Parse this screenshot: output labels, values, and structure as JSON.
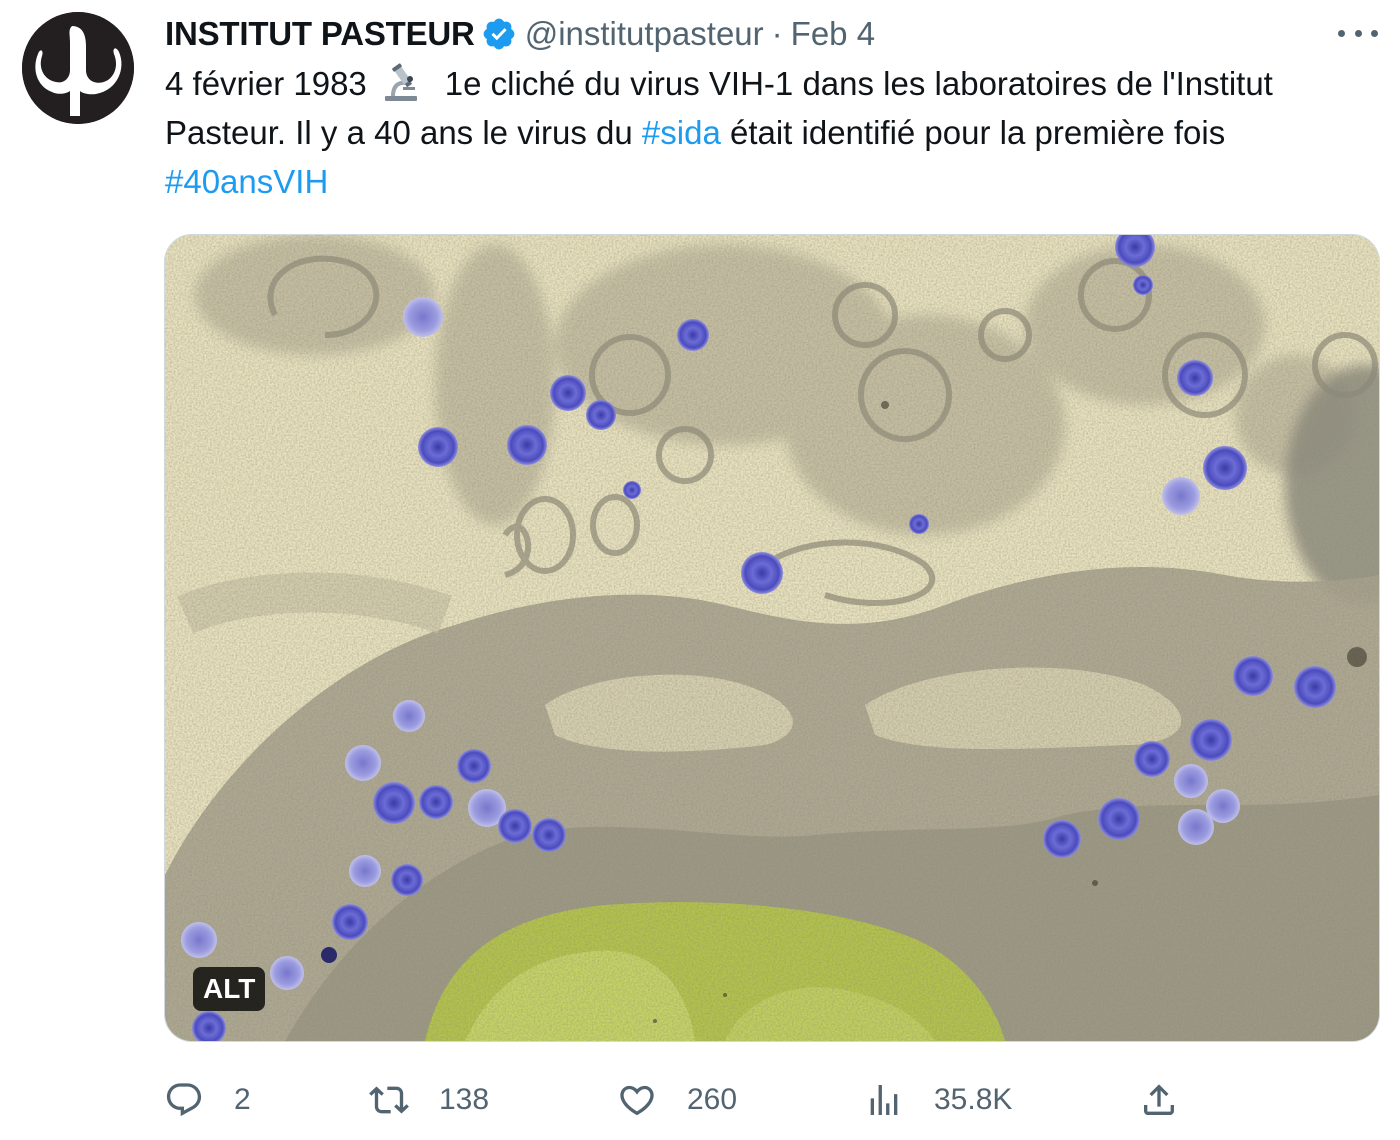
{
  "author": {
    "name": "INSTITUT PASTEUR",
    "handle": "@institutpasteur",
    "separator": "·",
    "date": "Feb 4",
    "verified": true,
    "avatar_icon": "institut-pasteur-logo"
  },
  "tweet": {
    "text_part1": "4 février 1983",
    "emoji_icon": "microscope-emoji",
    "text_part2": "1e cliché du virus VIH-1 dans les laboratoires de l'Institut Pasteur. Il y a 40 ans le virus du ",
    "hashtag1": "#sida",
    "text_part3": " était identifié pour la première fois ",
    "hashtag2": "#40ansVIH"
  },
  "media": {
    "alt_label": "ALT"
  },
  "actions": {
    "reply_count": "2",
    "retweet_count": "138",
    "like_count": "260",
    "views_count": "35.8K"
  },
  "colors": {
    "link": "#1d9bf0",
    "secondary_text": "#536471",
    "verified_badge": "#1d9bf0",
    "virus_particles": "#5b5bc8",
    "nucleus": "#b8c84a",
    "background_tint": "#e8e1bc"
  }
}
